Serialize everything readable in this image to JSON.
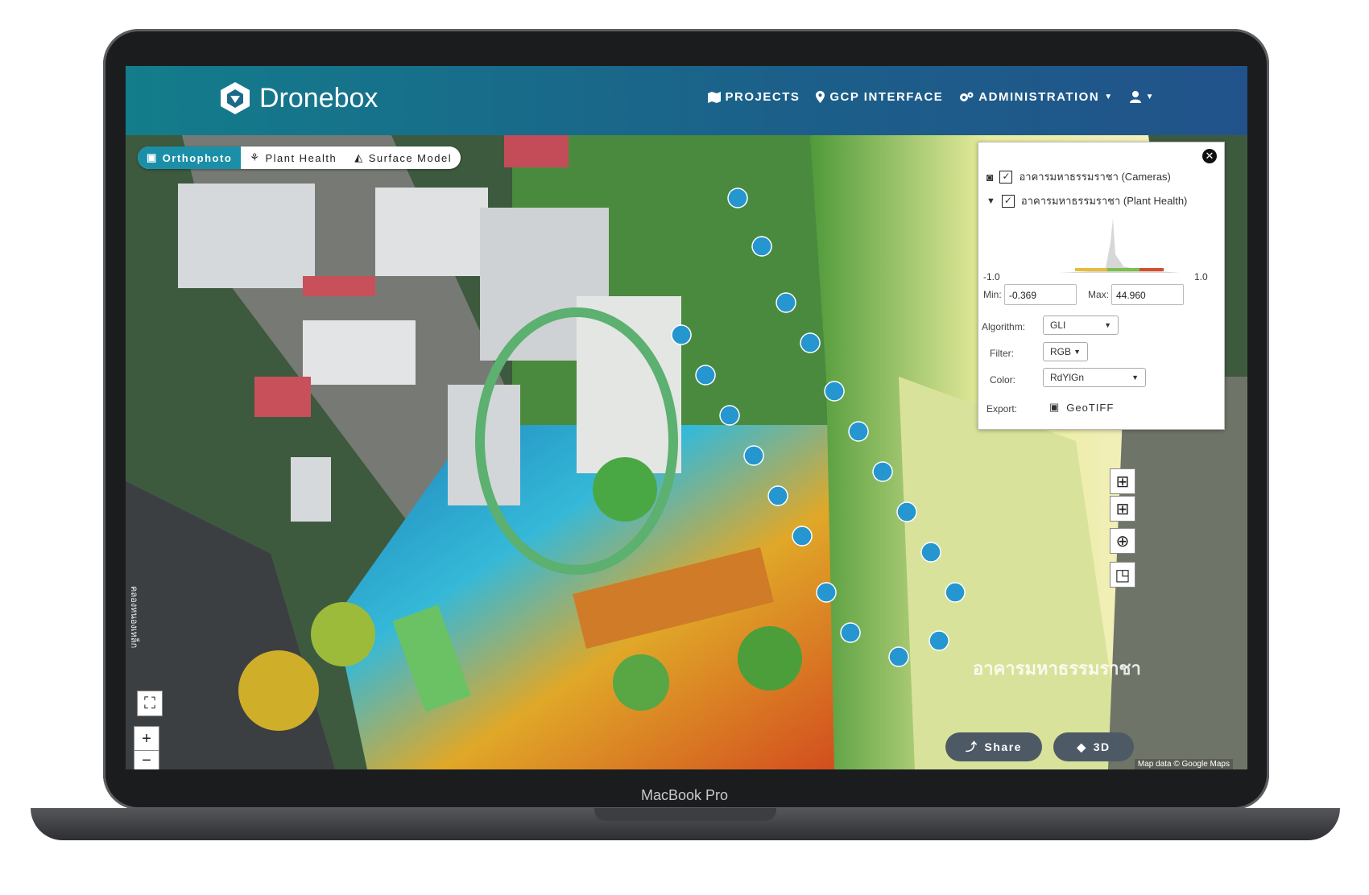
{
  "device": {
    "label": "MacBook Pro"
  },
  "navbar": {
    "brand": "Dronebox",
    "items": [
      {
        "label": "PROJECTS",
        "icon": "map-icon"
      },
      {
        "label": "GCP INTERFACE",
        "icon": "pin-icon"
      },
      {
        "label": "ADMINISTRATION",
        "icon": "gears-icon"
      }
    ]
  },
  "view_tabs": [
    {
      "label": "Orthophoto",
      "active": true
    },
    {
      "label": "Plant Health",
      "active": false
    },
    {
      "label": "Surface Model",
      "active": false
    }
  ],
  "layer_panel": {
    "layers": [
      {
        "label": "อาคารมหาธรรมราชา (Cameras)",
        "checked": true
      },
      {
        "label": "อาคารมหาธรรมราชา (Plant Health)",
        "checked": true
      }
    ],
    "hist_min": "-1.0",
    "hist_max": "1.0",
    "min_label": "Min:",
    "min_value": "-0.369",
    "max_label": "Max:",
    "max_value": "44.960",
    "algorithm_label": "Algorithm:",
    "algorithm_value": "GLI",
    "filter_label": "Filter:",
    "filter_value": "RGB",
    "color_label": "Color:",
    "color_value": "RdYlGn",
    "export_label": "Export:",
    "export_button": "GeoTIFF"
  },
  "map": {
    "title": "อาคารมหาธรรมราชา",
    "credit": "Map data © Google Maps",
    "road_label": "คลองหนองเหล็ก",
    "share_label": "Share",
    "view3d_label": "3D"
  },
  "colors": {
    "accent": "#1c8fa8",
    "navbar_left": "#137d8b",
    "navbar_right": "#21538a"
  }
}
